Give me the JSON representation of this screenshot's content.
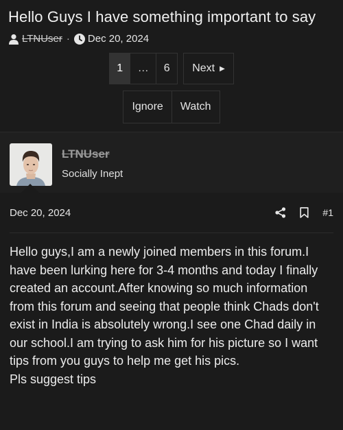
{
  "thread": {
    "title": "Hello Guys I have something important to say",
    "starter": "LTNUser",
    "separator": "·",
    "date": "Dec 20, 2024"
  },
  "pagination": {
    "pages": [
      "1",
      "…",
      "6"
    ],
    "current": "1",
    "next_label": "Next"
  },
  "thread_actions": {
    "ignore_label": "Ignore",
    "watch_label": "Watch"
  },
  "post": {
    "author": "LTNUser",
    "user_title": "Socially Inept",
    "date": "Dec 20, 2024",
    "number": "#1",
    "body_lines": [
      "Hello guys,I am a newly joined members in this forum.I have been lurking here for 3-4 months and today I finally created an account.After knowing so much information from this forum and seeing that people think Chads don't exist in India is absolutely wrong.I see one Chad daily in our school.I am trying to ask him for his picture so I want tips from you guys to help me get his pics.",
      "Pls suggest tips"
    ]
  },
  "icons": {
    "user": "user-icon",
    "clock": "clock-icon",
    "share": "share-icon",
    "bookmark": "bookmark-icon",
    "next_arrow": "caret-right-icon"
  }
}
